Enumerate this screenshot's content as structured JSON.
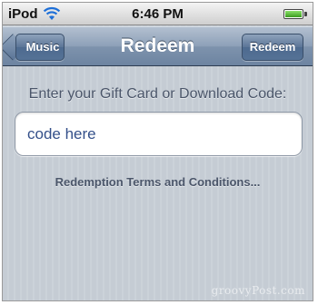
{
  "status_bar": {
    "carrier": "iPod",
    "time": "6:46 PM",
    "icons": [
      "wifi-icon",
      "battery-icon"
    ],
    "battery_level": 1.0
  },
  "nav_bar": {
    "back_label": "Music",
    "title": "Redeem",
    "action_label": "Redeem"
  },
  "content": {
    "prompt": "Enter your Gift Card or Download Code:",
    "code_value": "code here",
    "terms_link": "Redemption Terms and Conditions..."
  },
  "watermark": "groovyPost.com",
  "colors": {
    "nav_bar": "#7e93ad",
    "background": "#c5ccd4",
    "field_text": "#34508a"
  }
}
